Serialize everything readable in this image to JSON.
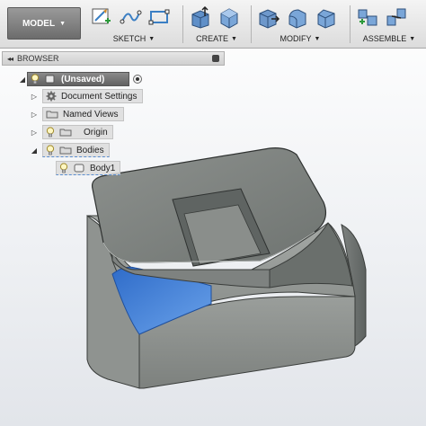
{
  "toolbar": {
    "mode_label": "MODEL",
    "groups": {
      "sketch": "SKETCH",
      "create": "CREATE",
      "modify": "MODIFY",
      "assemble": "ASSEMBLE"
    }
  },
  "browser": {
    "title": "BROWSER",
    "items": {
      "root": "(Unsaved)",
      "document_settings": "Document Settings",
      "named_views": "Named Views",
      "origin": "Origin",
      "bodies": "Bodies",
      "body1": "Body1"
    }
  },
  "colors": {
    "toolbar_bg": "#e4e4e4",
    "mode_button": "#7a7a7a",
    "icon_blue": "#3b7fc4",
    "body_gray": "#8a8e8b",
    "selected_face": "#3f7fd6"
  },
  "icons": {
    "mode": "chevron-down-icon",
    "sketch": [
      "create-sketch-icon",
      "spline-icon",
      "rectangle-icon"
    ],
    "create": [
      "extrude-icon",
      "box-icon"
    ],
    "modify": [
      "press-pull-icon",
      "fillet-icon",
      "chamfer-icon"
    ],
    "assemble": [
      "new-component-icon",
      "joint-icon"
    ]
  }
}
